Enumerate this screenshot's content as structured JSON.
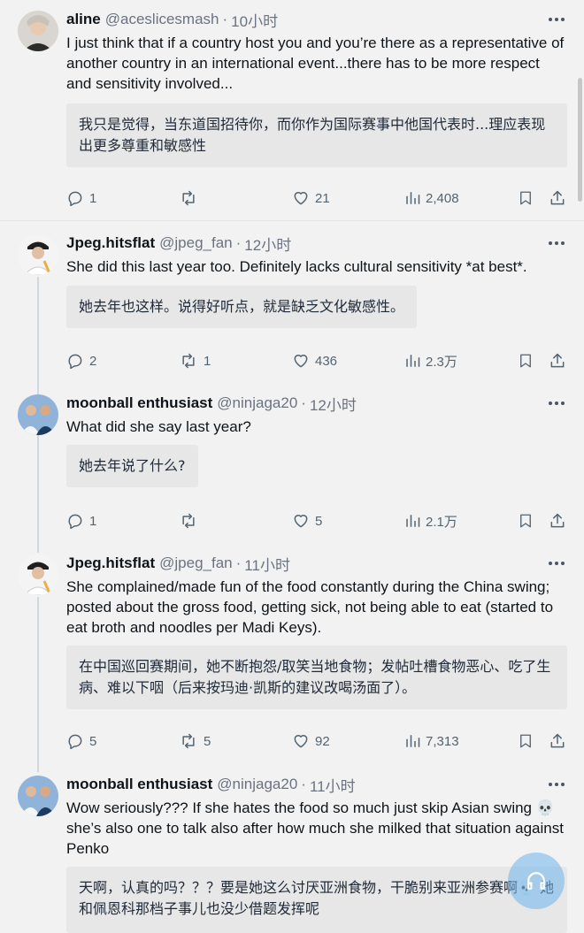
{
  "replies": [
    {
      "name": "aline",
      "handle": "@aceslicesmash",
      "dot": "·",
      "time": "10小时",
      "text": "I just think that if a country host you and you’re there as a representative of another country in an international event...there has to be more respect and sensitivity involved...",
      "translation": "我只是觉得，当东道国招待你，而你作为国际赛事中他国代表时...理应表现出更多尊重和敏感性",
      "stats": {
        "replies": "1",
        "reposts": "",
        "likes": "21",
        "views": "2,408"
      }
    },
    {
      "name": "Jpeg.hitsflat",
      "handle": "@jpeg_fan",
      "dot": "·",
      "time": "12小时",
      "text": "She did this last year too. Definitely lacks cultural sensitivity *at best*.",
      "translation": "她去年也这样。说得好听点，就是缺乏文化敏感性。",
      "stats": {
        "replies": "2",
        "reposts": "1",
        "likes": "436",
        "views": "2.3万"
      }
    },
    {
      "name": "moonball enthusiast",
      "handle": "@ninjaga20",
      "dot": "·",
      "time": "12小时",
      "text": "What did she say last year?",
      "translation": "她去年说了什么?",
      "stats": {
        "replies": "1",
        "reposts": "",
        "likes": "5",
        "views": "2.1万"
      }
    },
    {
      "name": "Jpeg.hitsflat",
      "handle": "@jpeg_fan",
      "dot": "·",
      "time": "11小时",
      "text": "She complained/made fun of the food constantly during the China swing; posted about the gross food, getting sick, not being able to eat (started to eat broth and noodles per Madi Keys).",
      "translation": "在中国巡回赛期间，她不断抱怨/取笑当地食物；发帖吐槽食物恶心、吃了生病、难以下咽（后来按玛迪·凯斯的建议改喝汤面了）。",
      "stats": {
        "replies": "5",
        "reposts": "5",
        "likes": "92",
        "views": "7,313"
      }
    },
    {
      "name": "moonball enthusiast",
      "handle": "@ninjaga20",
      "dot": "·",
      "time": "11小时",
      "text": "Wow seriously??? If she hates the food so much just skip Asian swing 💀 she’s also one to talk also after how much she milked that situation against Penko",
      "translation": "天啊，认真的吗？？？要是她这么讨厌亚洲食物，干脆别来亚洲参赛啊💀 她和佩恩科那档子事儿也没少借题发挥呢",
      "stats": {
        "replies": "",
        "reposts": "",
        "likes": "",
        "views": ""
      }
    }
  ],
  "icons": {
    "reply": "reply-icon",
    "repost": "repost-icon",
    "like": "like-icon",
    "views": "views-icon",
    "bookmark": "bookmark-icon",
    "share": "share-icon",
    "more": "more-icon"
  },
  "colors": {
    "background": "#f2f2f2",
    "translation_box": "#e7e7e7",
    "muted": "#536471",
    "fab": "#6eb4eb"
  }
}
